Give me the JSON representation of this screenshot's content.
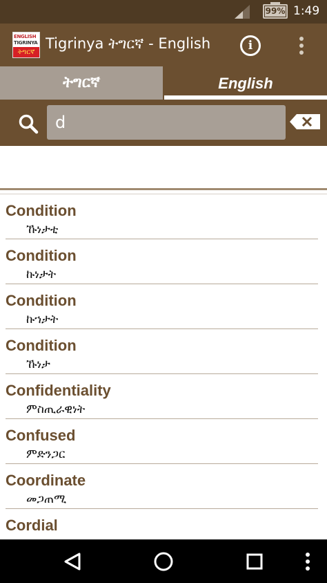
{
  "status_bar": {
    "battery_text": "99%",
    "time": "1:49"
  },
  "app_bar": {
    "logo_top": "ENGLISH",
    "logo_middle": "TIGRINYA",
    "logo_bottom": "ትግርኛ",
    "title": "Tigrinya ትግርኛ - English",
    "info_icon": "info-icon",
    "overflow_icon": "more-vert-icon"
  },
  "tabs": [
    {
      "label": "ትግርኛ",
      "selected": false
    },
    {
      "label": "English",
      "selected": true
    }
  ],
  "search": {
    "value": "d",
    "search_icon": "search-icon",
    "clear_icon": "backspace-icon"
  },
  "results": [
    {
      "english": "Condition",
      "tigrinya": "ኹነታቲ"
    },
    {
      "english": "Condition",
      "tigrinya": "ኩነታት"
    },
    {
      "english": "Condition",
      "tigrinya": "ኩኀታት"
    },
    {
      "english": "Condition",
      "tigrinya": "ኹነታ"
    },
    {
      "english": "Confidentiality",
      "tigrinya": "ምስጢራዊነት"
    },
    {
      "english": "Confused",
      "tigrinya": "ምድንጋር"
    },
    {
      "english": "Coordinate",
      "tigrinya": "መጋጠሚ"
    },
    {
      "english": "Cordial",
      "tigrinya": ""
    }
  ],
  "nav_bar": {
    "back_icon": "back-triangle-icon",
    "home_icon": "home-circle-icon",
    "recent_icon": "recent-apps-square-icon",
    "more_icon": "more-vert-icon"
  },
  "colors": {
    "primary": "#6b4f30",
    "status_bar": "#4e3a23",
    "tab_inactive": "#a79d93",
    "search_field": "#a89f96"
  }
}
